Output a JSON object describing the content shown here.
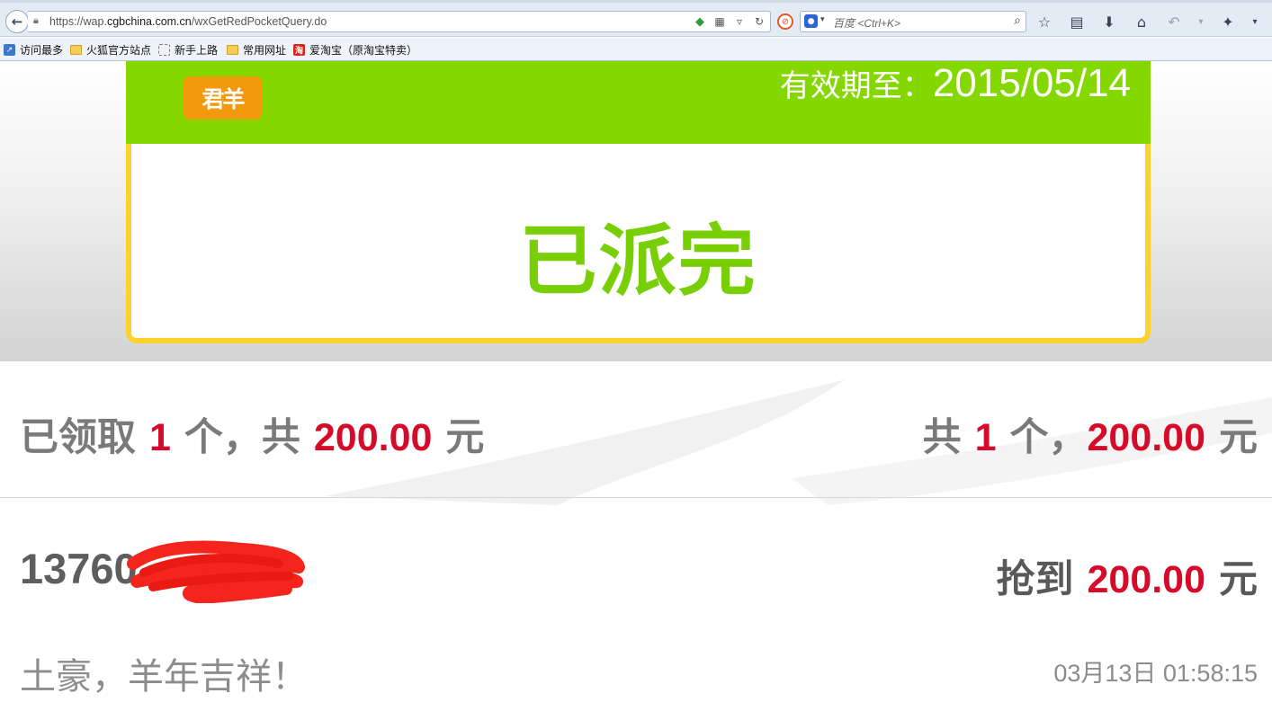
{
  "browser": {
    "url_prefix": "https://wap.",
    "url_domain": "cgbchina.com.cn",
    "url_path": "/wxGetRedPocketQuery.do",
    "search_placeholder": "百度 <Ctrl+K>",
    "engine_icon": "baidu-paw-icon"
  },
  "bookmarks": [
    {
      "label": "访问最多",
      "icon": "most-visited-icon"
    },
    {
      "label": "火狐官方站点",
      "icon": "folder-icon"
    },
    {
      "label": "新手上路",
      "icon": "dashed-page-icon"
    },
    {
      "label": "常用网址",
      "icon": "folder-icon"
    },
    {
      "label": "爱淘宝（原淘宝特卖）",
      "icon": "taobao-icon"
    }
  ],
  "card": {
    "logo_text": "君羊",
    "expiry_label": "有效期至：",
    "expiry_date": "2015/05/14",
    "status": "已派完",
    "header_color": "#84d800",
    "frame_color": "#fdd22c"
  },
  "summary": {
    "received_label": "已领取",
    "received_count": "1",
    "unit": "个",
    "sep": "，共",
    "received_amount": "200.00",
    "currency": "元",
    "total_label": "共",
    "total_count": "1",
    "total_sep": "，",
    "total_amount": "200.00"
  },
  "record": {
    "phone_prefix": "13760",
    "grab_label": "抢到",
    "amount": "200.00",
    "currency": "元",
    "message": "土豪，羊年吉祥！",
    "time": "03月13日 01:58:15"
  },
  "accent_red": "#d60b2a"
}
